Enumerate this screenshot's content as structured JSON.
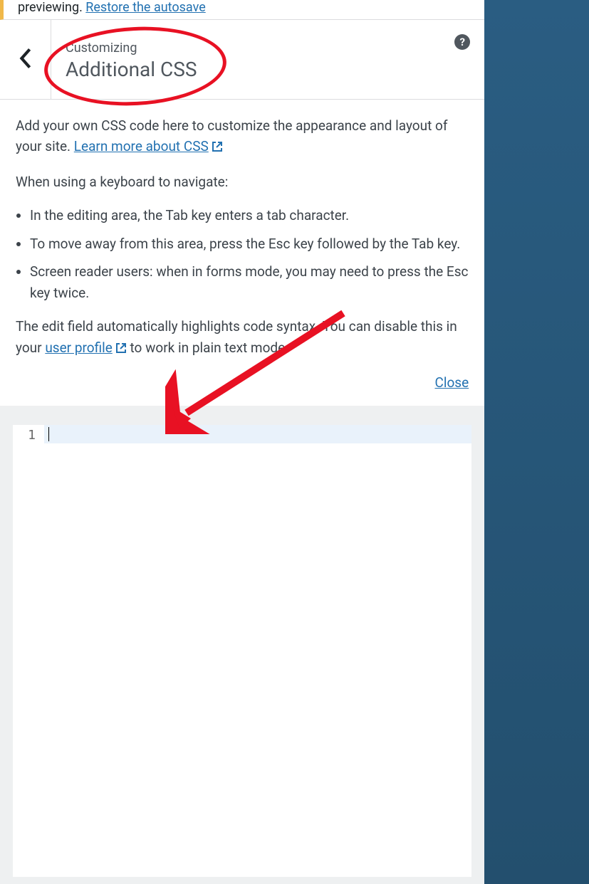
{
  "autosave": {
    "prefix": "previewing.",
    "link_text": "Restore the autosave"
  },
  "header": {
    "breadcrumb": "Customizing",
    "title": "Additional CSS"
  },
  "desc": {
    "p1_a": "Add your own CSS code here to customize the appearance and layout of your site. ",
    "p1_link": "Learn more about CSS",
    "p2": "When using a keyboard to navigate:",
    "li1": "In the editing area, the Tab key enters a tab character.",
    "li2": "To move away from this area, press the Esc key followed by the Tab key.",
    "li3": "Screen reader users: when in forms mode, you may need to press the Esc key twice.",
    "p3_a": "The edit field automatically highlights code syntax. You can disable this in your ",
    "p3_link": "user profile",
    "p3_b": " to work in plain text mode.",
    "close": "Close"
  },
  "editor": {
    "line_number": "1"
  }
}
